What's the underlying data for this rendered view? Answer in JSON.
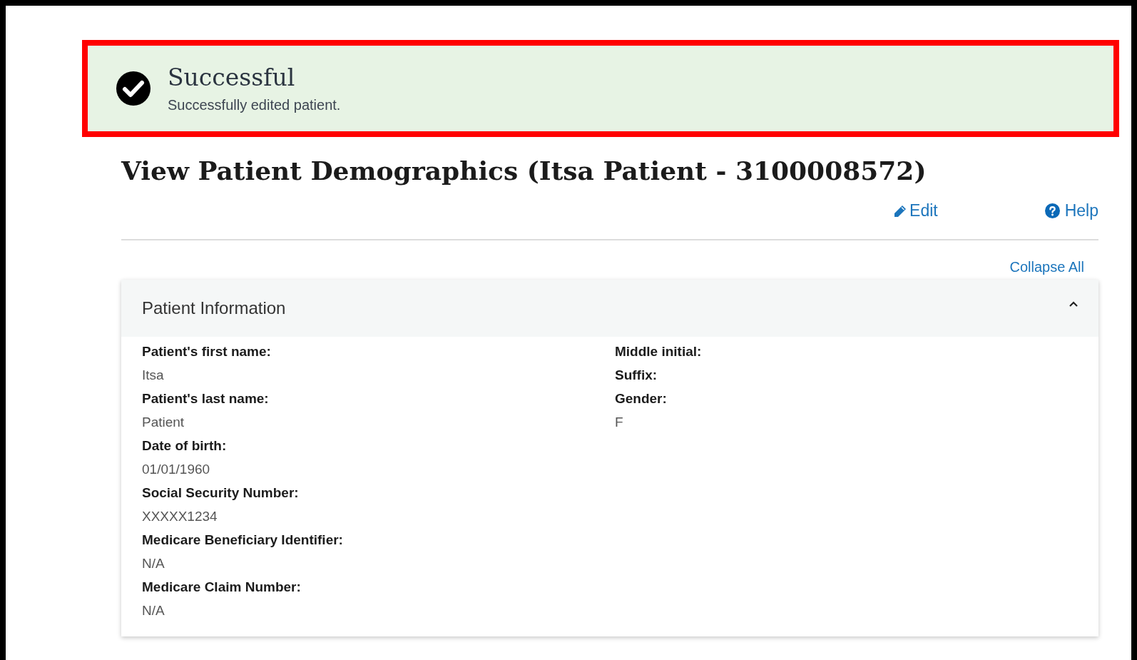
{
  "alert": {
    "kind": "success",
    "title": "Successful",
    "message": "Successfully edited patient.",
    "highlighted": true
  },
  "page": {
    "title": "View Patient Demographics (Itsa Patient - 3100008572)"
  },
  "actions": [
    {
      "kind": "edit",
      "label": "Edit"
    },
    {
      "kind": "help",
      "label": "Help"
    }
  ],
  "collapse_link": "Collapse All",
  "panel": {
    "title": "Patient Information",
    "expanded": true,
    "columns": [
      [
        {
          "label": "Patient's first name:",
          "value": "Itsa"
        },
        {
          "label": "Patient's last name:",
          "value": "Patient"
        },
        {
          "label": "Date of birth:",
          "value": "01/01/1960"
        },
        {
          "label": "Social Security Number:",
          "value": "XXXXX1234"
        },
        {
          "label": "Medicare Beneficiary Identifier:",
          "value": "N/A"
        },
        {
          "label": "Medicare Claim Number:",
          "value": "N/A"
        }
      ],
      [
        {
          "label": "Middle initial:"
        },
        {
          "label": "Suffix:"
        },
        {
          "label": "Gender:",
          "value": "F"
        }
      ]
    ]
  }
}
